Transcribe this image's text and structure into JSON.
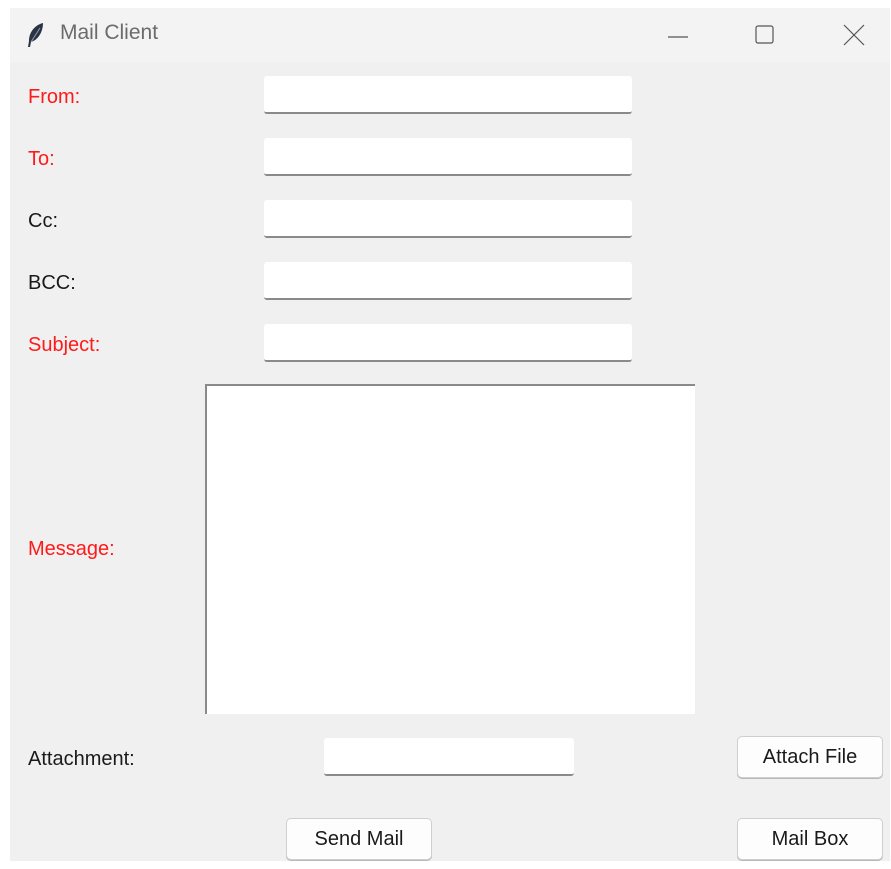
{
  "window": {
    "title": "Mail Client",
    "controls": [
      "minimize-icon",
      "maximize-icon",
      "close-icon"
    ]
  },
  "form": {
    "from_label": "From:",
    "to_label": "To:",
    "cc_label": "Cc:",
    "bcc_label": "BCC:",
    "subject_label": "Subject:",
    "message_label": "Message:",
    "attachment_label": "Attachment:",
    "from_value": "",
    "to_value": "",
    "cc_value": "",
    "bcc_value": "",
    "subject_value": "",
    "message_value": "",
    "attachment_value": ""
  },
  "buttons": {
    "attach_file": "Attach File",
    "send_mail": "Send Mail",
    "mail_box": "Mail Box"
  },
  "colors": {
    "required_label": "#ff1a1a",
    "normal_label": "#1a1a1a",
    "background": "#f0f0f0"
  }
}
